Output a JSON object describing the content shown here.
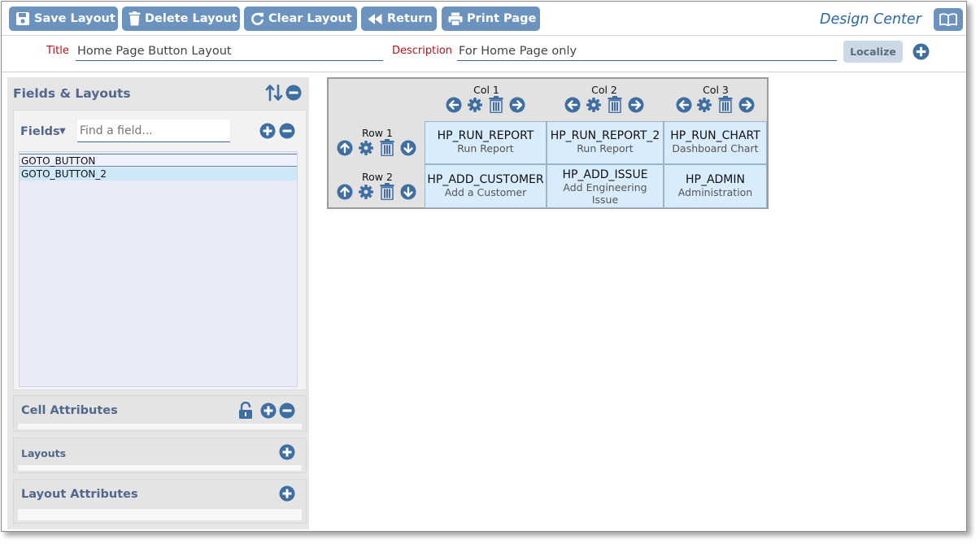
{
  "toolbar": {
    "save_label": "Save Layout",
    "delete_label": "Delete Layout",
    "clear_label": "Clear Layout",
    "return_label": "Return",
    "print_label": "Print Page",
    "app_title": "Design Center"
  },
  "form": {
    "title_label": "Title",
    "title_value": "Home Page Button Layout",
    "description_label": "Description",
    "description_value": "For Home Page only",
    "localize_label": "Localize"
  },
  "left_panel": {
    "title": "Fields & Layouts",
    "fields_label": "Fields",
    "find_placeholder": "Find a field...",
    "fields": [
      "GOTO_BUTTON",
      "GOTO_BUTTON_2"
    ],
    "cell_attributes_label": "Cell Attributes",
    "layouts_label": "Layouts",
    "layout_attributes_label": "Layout Attributes"
  },
  "grid": {
    "columns": [
      "Col 1",
      "Col 2",
      "Col 3"
    ],
    "rows": [
      {
        "label": "Row 1",
        "cells": [
          {
            "name": "HP_RUN_REPORT",
            "desc": "Run Report"
          },
          {
            "name": "HP_RUN_REPORT_2",
            "desc": "Run Report"
          },
          {
            "name": "HP_RUN_CHART",
            "desc": "Dashboard Chart"
          }
        ]
      },
      {
        "label": "Row 2",
        "cells": [
          {
            "name": "HP_ADD_CUSTOMER",
            "desc": "Add a Customer"
          },
          {
            "name": "HP_ADD_ISSUE",
            "desc": "Add Engineering Issue"
          },
          {
            "name": "HP_ADMIN",
            "desc": "Administration"
          }
        ]
      }
    ]
  },
  "colors": {
    "accent": "#2a69a5",
    "button_bg": "#6b93bd",
    "cell_bg": "#d9ecfb",
    "label_red": "#b0141c"
  },
  "icons": [
    "save-icon",
    "trash-icon",
    "refresh-icon",
    "rewind-icon",
    "print-icon",
    "book-icon",
    "plus-circle-icon",
    "minus-circle-icon",
    "sort-icon",
    "unlock-icon",
    "arrow-left-icon",
    "arrow-right-icon",
    "arrow-up-icon",
    "arrow-down-icon",
    "gear-icon"
  ]
}
